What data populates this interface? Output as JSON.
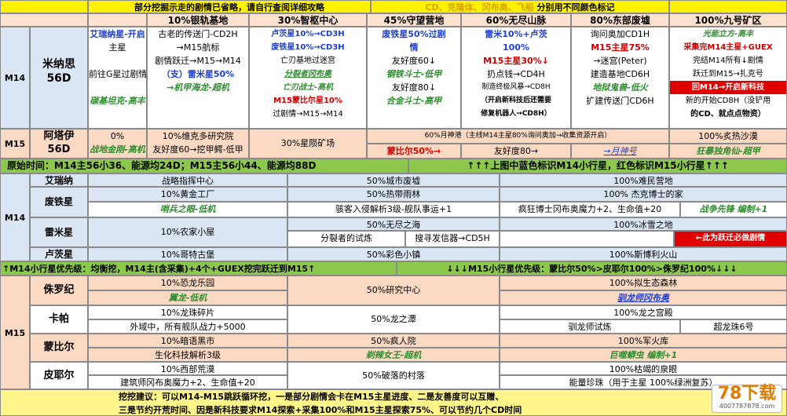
{
  "header": {
    "note": "部分挖掘示走的剧情已省略，请自行查阅详细攻略",
    "legend": "CD、克隆体、冈布奥、飞船",
    "legend_suffix": "分别用不同颜色标记",
    "cols": [
      "10%银轨基地",
      "30%智枢中心",
      "45%守望营地",
      "60%无尽山脉",
      "80%东部废墟",
      "100%九号矿区"
    ]
  },
  "m14_row": {
    "label": "M14",
    "planet": "米纳思",
    "planet_days": "56D",
    "col0": [
      "艾瑞纳星-开启",
      "主星",
      "",
      "前往G星过剧情",
      "",
      "碳基坦克-高丰"
    ],
    "col1": [
      "古老的传送门-CD2H",
      "→M15航标",
      "剧情跃迁→M15→M14",
      "（支）雷米星50%",
      "→机甲海龙-超机"
    ],
    "col2": [
      "卢茨星10%→CD3H",
      "废铁星10%→CD3H",
      "亡刃基地过迷宫",
      "分裂者冈布奥",
      "亡刃战士-高机",
      "M15蒙比尔星10%",
      "过剧情→M15→M14"
    ],
    "col3": [
      "废铁星50%过剧",
      "情",
      "友好度60↓",
      "友好度80↓",
      "钢铁斗士-低甲",
      "合金斗士-高甲"
    ],
    "col4": [
      "雷米10%+卢茨",
      "100%",
      "M15主星30%↓",
      "扔点钱→CD4H",
      "制造终极风暴→CD8H",
      "（开启新科技后还需要",
      "修复机器人→CD8H）"
    ],
    "col5": [
      "询问奥加CD1H",
      "M15主星75%",
      "→迷宫(Peter)",
      "建造基地CD6H",
      "地狱鬼兽-低火",
      "扩建传送门CD6H"
    ],
    "col6": [
      "光能立方-高丰",
      "采集完M14主星+GUEX",
      "完结M14所有↓剧情",
      "跃迁到M15→扎克号",
      "回M14→开启新科技",
      "新的开始CD8H（没铲用",
      "的CD、就点点物资）"
    ]
  },
  "m15_row": {
    "label": "M15",
    "planet": "阿塔伊",
    "planet_days": "56D",
    "col0": [
      "0%",
      "战地金刚-高机"
    ],
    "col1": [
      "10%维克多研究院",
      "友好度60→挖甲鳄-低甲"
    ],
    "col2": "30%星陨矿场",
    "col3_top": "60%月神港（主线M14主星80%询问奥加→收集资源开启）",
    "col3_a": "蒙比尔50%→",
    "col3_b": "友好度80→",
    "col3_c": "→月神号",
    "col6_top": "100%炙热沙漠",
    "col6": "狂暴独角仙-超甲"
  },
  "origin_bar": {
    "left": "原始时间：M14主56小36、能源均24D；M15主56小44、能源均88D",
    "right": "↑↑↑上图中蓝色标识M14小行星，红色标识M15小行星↑↑↑"
  },
  "m14_small": {
    "label": "M14",
    "rows": [
      {
        "name": "艾瑞纳",
        "c1": "战略指挥中心",
        "c2": "50%城市废墟",
        "c3": "100%难民营地"
      },
      {
        "name": "废铁星",
        "c1": "10%黄金工厂",
        "c1b": "哨兵之眼-低机",
        "c2": "50%热带雨林",
        "c2b": "骇客入侵解析3级-舰队事运+1",
        "c3": "100% 杰克博士的家",
        "c3b": "疯狂博士冈布奥魔力+2、生命值+20",
        "c3c": "战争先锋 编制+1"
      },
      {
        "name": "雷米星",
        "c1": "10%农家小屋",
        "c2": "50%无尽之海",
        "c2b": "分裂者的试炼",
        "c2c": "搜寻发信器→CD5H",
        "c3": "100%冰雪之地",
        "c3b": "←此为跃迁必做剧情"
      },
      {
        "name": "卢茨星",
        "c1": "10%哥特古堡",
        "c2": "50%彩色小镇",
        "c3": "100%斯博利火山"
      }
    ]
  },
  "priority_bar": {
    "left": "↑M14小行星优先级：均衡挖，M14主(含采集)+4个+GUEX挖完跃迁到M15↑",
    "right": "↓↓↓M15小行星优先级：蒙比尔50%>皮耶尔100%>侏罗纪100%↓↓↓"
  },
  "m15_small": {
    "label": "M15",
    "rows": [
      {
        "name": "侏罗纪",
        "c1": "10%恐龙乐园",
        "c1b": "翼龙-低机",
        "c2": "50%研究中心",
        "c3": "100%拟生态森林",
        "c3b": "驯龙师冈布奥"
      },
      {
        "name": "卡帕",
        "c1": "10%龙珠碎片",
        "c1b": "外域中，所有舰队战力+5000",
        "c2": "50%龙之潭",
        "c3": "100%龙之宫殿",
        "c3b": "驯龙师试炼",
        "c3c": "超龙珠6号"
      },
      {
        "name": "蒙比尔",
        "c1": "10%暗语黑市",
        "c1b": "生化科技解析3级",
        "c2": "50%疯人院",
        "c2b": "剃辣女王-超机",
        "c3": "100%军火库",
        "c3b": "巨噬蟒虫 编制+1"
      },
      {
        "name": "皮耶尔",
        "c1": "10%西部荒漠",
        "c1b": "建筑师冈布奥魔力+2、生命值+20",
        "c2": "50%破落的村落",
        "c3": "100%枯竭的泉眼",
        "c3b": "能量珍珠（用于主星 100%绿洲复苏）"
      }
    ]
  },
  "footer": {
    "line1": "挖挖建议：可以M14-M15跳跃循环挖，一是部分剧情会卡在M15主星进度、二是友善度可以互赠、",
    "line2": "三是节约开荒时间、因是新科技要求M14探索+采集100%和M15主星探索75%、可以节约几个CD时间"
  },
  "logo": {
    "text": "78下载",
    "url_text": "4007787878.com"
  }
}
